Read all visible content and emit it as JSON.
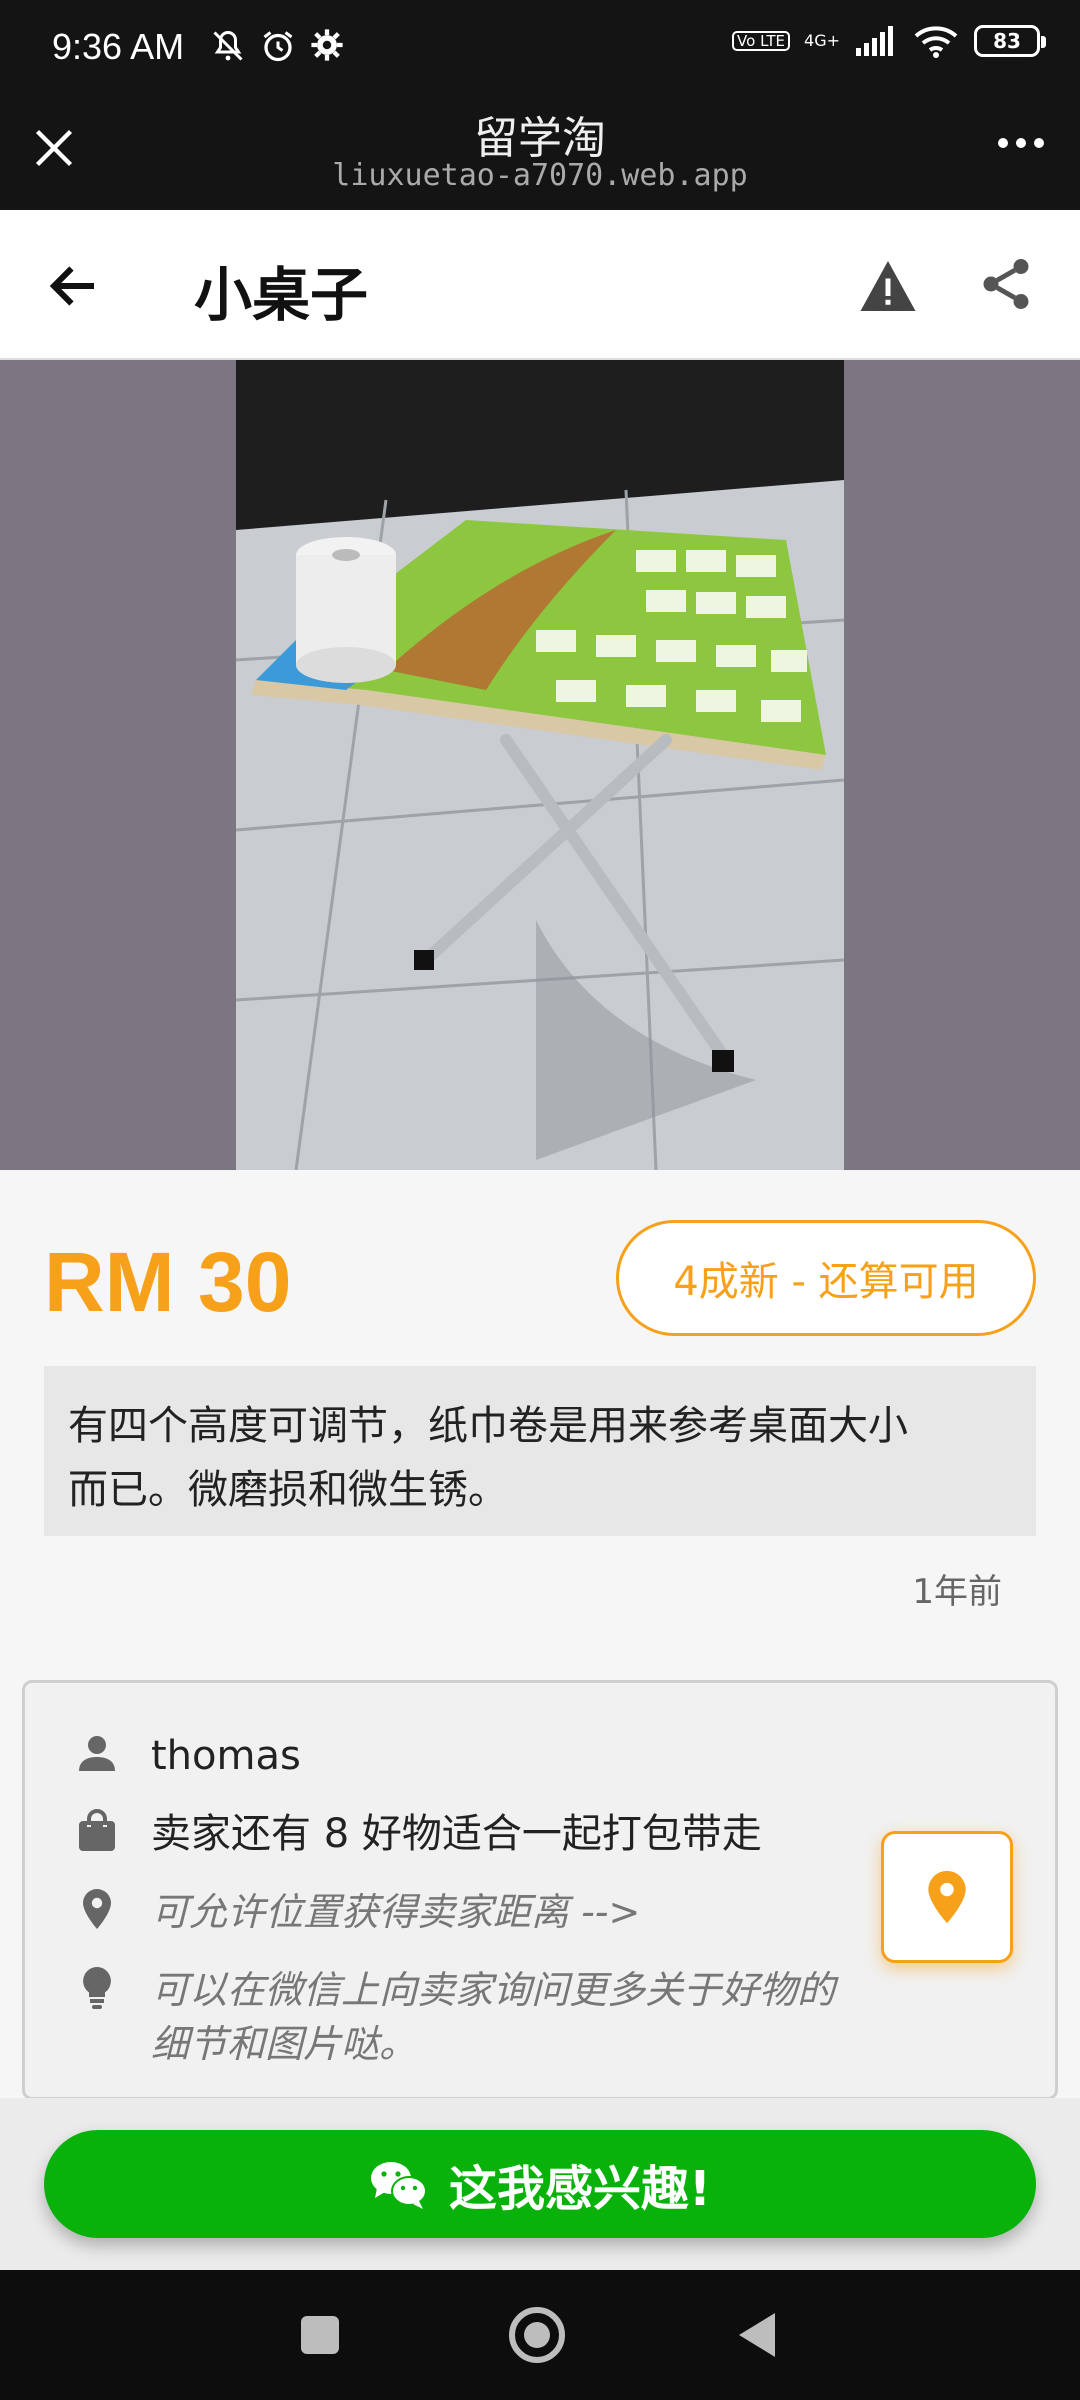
{
  "status_bar": {
    "time": "9:36",
    "ampm": "AM",
    "network": "4G+",
    "volte": "Vo LTE",
    "battery": "83",
    "icons": [
      "mute-icon",
      "alarm-icon",
      "settings-icon",
      "signal-icon",
      "wifi-icon",
      "battery-icon"
    ]
  },
  "browser": {
    "title": "留学淘",
    "url": "liuxuetao-a7070.web.app"
  },
  "header": {
    "title": "小桌子"
  },
  "product": {
    "image_desc": "folding table photo",
    "price": "RM 30",
    "condition": "4成新 - 还算可用",
    "description_line1": "有四个高度可调节，纸巾卷是用来参考桌面大小",
    "description_line2": "而已。微磨损和微生锈。",
    "posted": "1年前"
  },
  "seller": {
    "name": "thomas",
    "more_items": "卖家还有 8 好物适合一起打包带走",
    "location_hint": "可允许位置获得卖家距离 -->",
    "tip_line1": "可以在微信上向卖家询问更多关于好物的",
    "tip_line2": "细节和图片哒。"
  },
  "actions": {
    "interest_label": "这我感兴趣!"
  },
  "colors": {
    "accent": "#f7a01a",
    "wechat_green": "#09b20a",
    "browser_bg": "#141414"
  }
}
